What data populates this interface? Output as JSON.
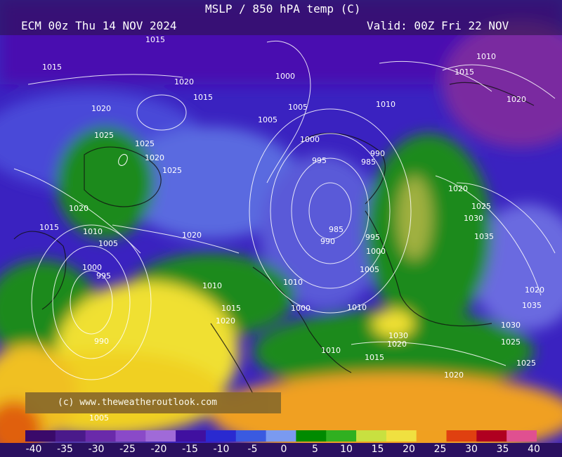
{
  "header": {
    "title": "MSLP / 850 hPA temp (C)",
    "run": "ECM 00z Thu 14 NOV 2024",
    "valid": "Valid: 00Z Fri 22 NOV"
  },
  "copyright": "(c) www.theweatheroutlook.com",
  "legend": {
    "ticks": [
      "-40",
      "-35",
      "-30",
      "-25",
      "-20",
      "-15",
      "-10",
      "-5",
      "0",
      "5",
      "10",
      "15",
      "20",
      "25",
      "30",
      "35",
      "40"
    ],
    "colors": [
      "#3a0a6a",
      "#4a1a8a",
      "#6a2aaa",
      "#8a4ac8",
      "#a06ad8",
      "#4010a0",
      "#2a2ad0",
      "#3a5ae0",
      "#7a9af0",
      "#008a00",
      "#30b020",
      "#c8e040",
      "#f0e040",
      "#f0a020",
      "#e04010",
      "#b00020",
      "#e05090"
    ]
  },
  "isobars": [
    "1015",
    "1015",
    "1020",
    "1015",
    "1000",
    "1005",
    "1005",
    "1010",
    "1015",
    "1020",
    "1020",
    "1025",
    "1025",
    "1020",
    "1025",
    "1020",
    "1000",
    "995",
    "990",
    "985",
    "1010",
    "1030",
    "1035",
    "1025",
    "1020",
    "1015",
    "1010",
    "1005",
    "1000",
    "995",
    "990",
    "985",
    "990",
    "995",
    "1000",
    "1005",
    "1010",
    "1010",
    "1015",
    "1020",
    "1020",
    "1025",
    "1030",
    "1035",
    "1030",
    "1025",
    "1020",
    "1010",
    "1015",
    "1020",
    "1005",
    "1000",
    "1010",
    "1020"
  ]
}
